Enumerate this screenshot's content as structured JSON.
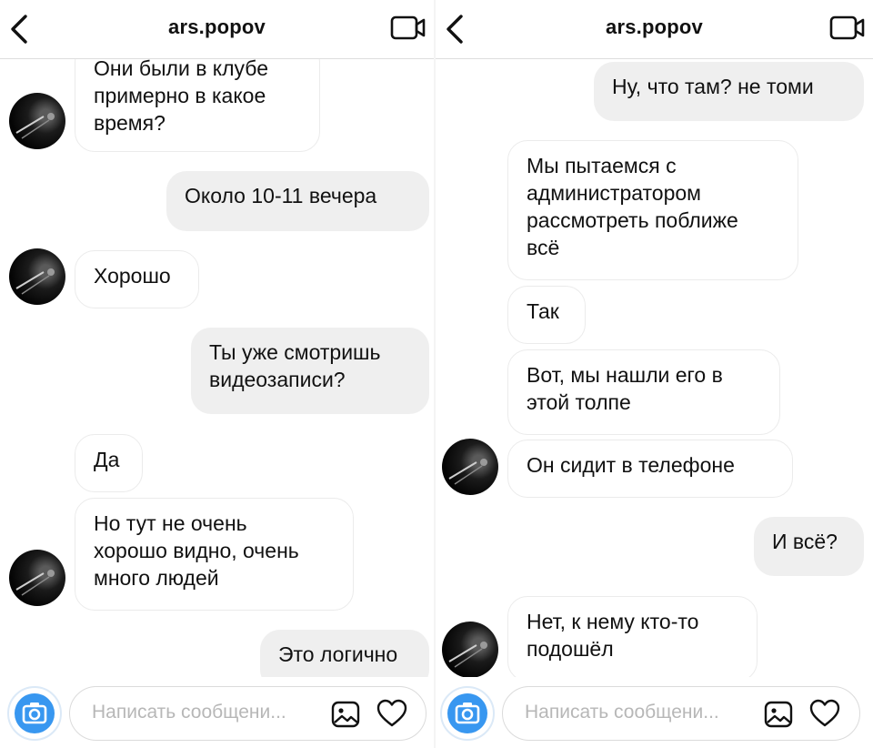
{
  "screens": [
    {
      "header": {
        "title": "ars.popov"
      },
      "composer": {
        "placeholder": "Написать сообщени..."
      },
      "messages": [
        {
          "side": "in",
          "text": "Они были в клубе\nпримерно в какое\nвремя?"
        },
        {
          "side": "out",
          "text": "Около 10-11 вечера"
        },
        {
          "side": "in",
          "text": "Хорошо"
        },
        {
          "side": "out",
          "text": "Ты уже смотришь\nвидеозаписи?"
        },
        {
          "side": "in",
          "text": "Да"
        },
        {
          "side": "in",
          "text": "Но тут не очень\nхорошо видно, очень\nмного людей"
        },
        {
          "side": "out",
          "text": "Это логично"
        }
      ]
    },
    {
      "header": {
        "title": "ars.popov"
      },
      "composer": {
        "placeholder": "Написать сообщени..."
      },
      "messages": [
        {
          "side": "out",
          "text": "Ну, что там? не томи"
        },
        {
          "side": "in",
          "text": "Мы пытаемся с\nадминистратором\nрассмотреть поближе\nвсё"
        },
        {
          "side": "in",
          "text": "Так"
        },
        {
          "side": "in",
          "text": "Вот, мы нашли его в\nэтой толпе"
        },
        {
          "side": "in",
          "text": "Он сидит в телефоне"
        },
        {
          "side": "out",
          "text": "И всё?"
        },
        {
          "side": "in",
          "text": "Нет, к нему кто-то\nподошёл"
        }
      ]
    }
  ],
  "icons": {
    "back": "chevron-left-icon",
    "video": "video-camera-icon",
    "camera": "camera-icon",
    "gallery": "gallery-icon",
    "like": "heart-icon"
  },
  "colors": {
    "accent": "#3897f0",
    "outgoing_bubble": "#efefef",
    "incoming_border": "#ebebeb",
    "placeholder": "#b7b7b7"
  }
}
